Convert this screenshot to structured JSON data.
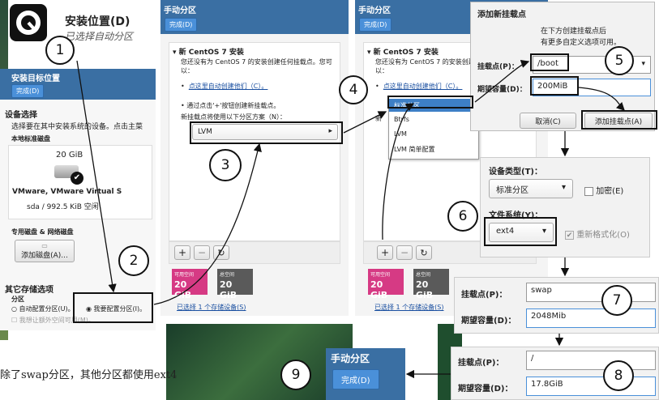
{
  "p1": {
    "title": "安装位置(D)",
    "subtitle": "已选择自动分区",
    "hdr_title": "安装目标位置",
    "done": "完成(D)",
    "device_selection": "设备选择",
    "device_desc": "选择要在其中安装系统的设备。点击主菜",
    "local_disks": "本地标准磁盘",
    "disk_size": "20 GiB",
    "disk_name": "VMware, VMware Virtual S",
    "disk_info": "sda  /  992.5 KiB 空闲",
    "special_disks": "专用磁盘 & 网络磁盘",
    "add_disk": "添加磁盘(A)...",
    "other_options": "其它存储选项",
    "partition": "分区",
    "auto_option": "自动配置分区(U)。",
    "manual_option": "我要配置分区(I)。",
    "extra_space": "我想让额外空间可用(M)。"
  },
  "p2": {
    "title": "手动分区",
    "done": "完成(D)",
    "install_title": "新 CentOS 7 安装",
    "install_desc": "您还没有为 CentOS 7 的安装创建任何挂载点。您可以：",
    "auto_link": "点这里自动创建他们（C）。",
    "manual_hint": "通过点击'+'按钮创建新挂载点。",
    "scheme_hint": "新挂载点将使用以下分区方案（N）：",
    "scheme_value": "LVM",
    "add_label": "+",
    "remove_label": "−",
    "refresh_label": "↻",
    "avail_label": "可用空间",
    "avail_value": "20 GiB",
    "total_label": "总空间",
    "total_value": "20 GiB",
    "storage_link": "已选择 1 个存储设备(S)"
  },
  "p3": {
    "title": "手动分区",
    "done": "完成(D)",
    "install_title": "新 CentOS 7 安装",
    "install_desc": "您还没有为 CentOS 7 的安装创建任何挂载点。您可以：",
    "auto_link": "点这里自动创建他们（C）。",
    "new_label": "新",
    "options": [
      "标准分区",
      "Btrfs",
      "LVM",
      "LVM 简单配置"
    ],
    "add_label": "+",
    "remove_label": "−",
    "refresh_label": "↻",
    "avail_label": "可用空间",
    "avail_value": "20 GiB",
    "total_label": "总空间",
    "total_value": "20 GiB",
    "storage_link": "已选择 1 个存储设备(S)"
  },
  "dlg": {
    "title": "添加新挂载点",
    "desc1": "在下方创建挂载点后",
    "desc2": "有更多自定义选项可用。",
    "mount_label": "挂载点(P)：",
    "mount_value": "/boot",
    "capacity_label": "期望容量(D)：",
    "capacity_value": "200MiB",
    "cancel": "取消(C)",
    "add": "添加挂载点(A)"
  },
  "dev": {
    "type_label": "设备类型(T)：",
    "type_value": "标准分区",
    "encrypt": "加密(E)",
    "fs_label": "文件系统(Y)：",
    "fs_value": "ext4",
    "reformat": "重新格式化(O)"
  },
  "swap": {
    "mount_label": "挂载点(P)：",
    "mount_value": "swap",
    "capacity_label": "期望容量(D)：",
    "capacity_value": "2048Mib"
  },
  "root": {
    "mount_label": "挂载点(P)：",
    "mount_value": "/",
    "capacity_label": "期望容量(D)：",
    "capacity_value": "17.8GiB"
  },
  "final": {
    "title": "手动分区",
    "done": "完成(D)"
  },
  "note": "除了swap分区，其他分区都使用ext4",
  "steps": [
    "1",
    "2",
    "3",
    "4",
    "5",
    "6",
    "7",
    "8",
    "9"
  ],
  "colors": {
    "header_blue": "#3a6fa3",
    "done_blue": "#4a90d9",
    "avail_pink": "#d63a84",
    "total_gray": "#5a5a5a",
    "background_green": "#1f4e2e",
    "selected_row": "#3d7fc6"
  }
}
